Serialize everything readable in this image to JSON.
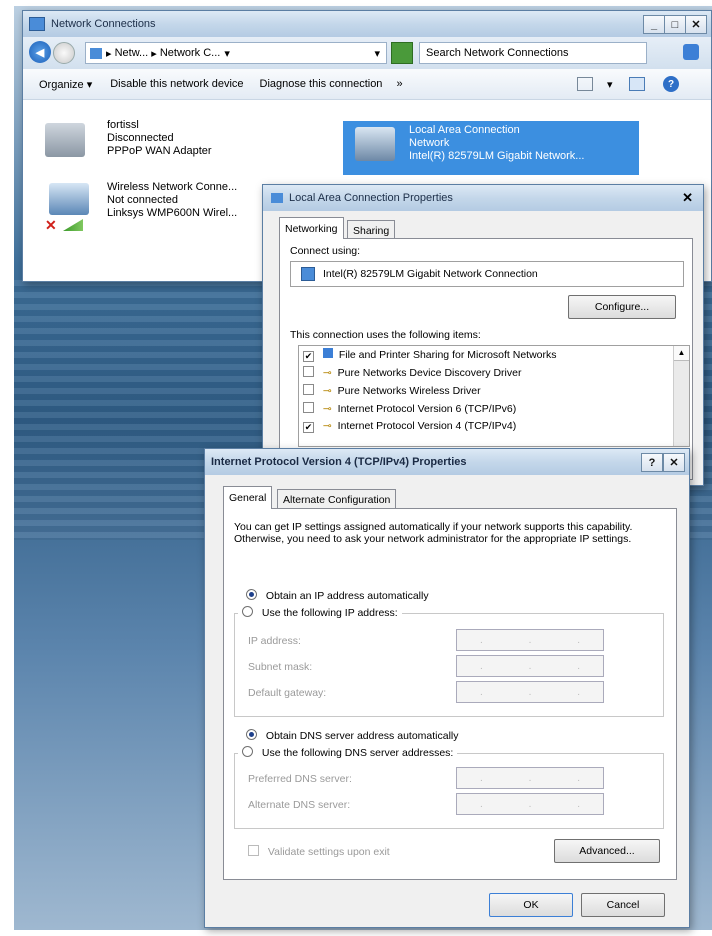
{
  "network_window": {
    "title": "Network Connections",
    "min": "_",
    "max": "□",
    "close": "✕",
    "address": {
      "seg1": "Netw...",
      "seg2": "Network C..."
    },
    "search_placeholder": "Search Network Connections",
    "toolbar": {
      "organize": "Organize",
      "disable": "Disable this network device",
      "diagnose": "Diagnose this connection",
      "more": "»"
    },
    "connections": [
      {
        "name": "fortissl",
        "status": "Disconnected",
        "device": "PPPoP WAN Adapter"
      },
      {
        "name": "Local Area Connection",
        "status": "Network",
        "device": "Intel(R) 82579LM Gigabit Network..."
      },
      {
        "name": "Wireless Network Conne...",
        "status": "Not connected",
        "device": "Linksys WMP600N Wirel..."
      }
    ]
  },
  "lan_props": {
    "title": "Local Area Connection Properties",
    "close": "✕",
    "tabs": [
      "Networking",
      "Sharing"
    ],
    "connect_using_label": "Connect using:",
    "adapter": "Intel(R) 82579LM Gigabit Network Connection",
    "configure": "Configure...",
    "items_label": "This connection uses the following items:",
    "items": [
      {
        "label": "File and Printer Sharing for Microsoft Networks",
        "checked": true
      },
      {
        "label": "Pure Networks Device Discovery Driver",
        "checked": false
      },
      {
        "label": "Pure Networks Wireless Driver",
        "checked": false
      },
      {
        "label": "Internet Protocol Version 6 (TCP/IPv6)",
        "checked": false
      },
      {
        "label": "Internet Protocol Version 4 (TCP/IPv4)",
        "checked": true
      }
    ]
  },
  "ipv4": {
    "title": "Internet Protocol Version 4 (TCP/IPv4) Properties",
    "help": "?",
    "close": "✕",
    "tabs": [
      "General",
      "Alternate Configuration"
    ],
    "intro": "You can get IP settings assigned automatically if your network supports this capability. Otherwise, you need to ask your network administrator for the appropriate IP settings.",
    "obtain_ip": "Obtain an IP address automatically",
    "use_ip": "Use the following IP address:",
    "ip_address": "IP address:",
    "subnet_mask": "Subnet mask:",
    "default_gateway": "Default gateway:",
    "obtain_dns": "Obtain DNS server address automatically",
    "use_dns": "Use the following DNS server addresses:",
    "preferred_dns": "Preferred DNS server:",
    "alternate_dns": "Alternate DNS server:",
    "validate": "Validate settings upon exit",
    "advanced": "Advanced...",
    "ok": "OK",
    "cancel": "Cancel",
    "ip_dots": "."
  },
  "colors": {
    "accent": "#3c7fd6",
    "title_bar": "#c4d7ea",
    "desktop": "#3e6f9a"
  }
}
